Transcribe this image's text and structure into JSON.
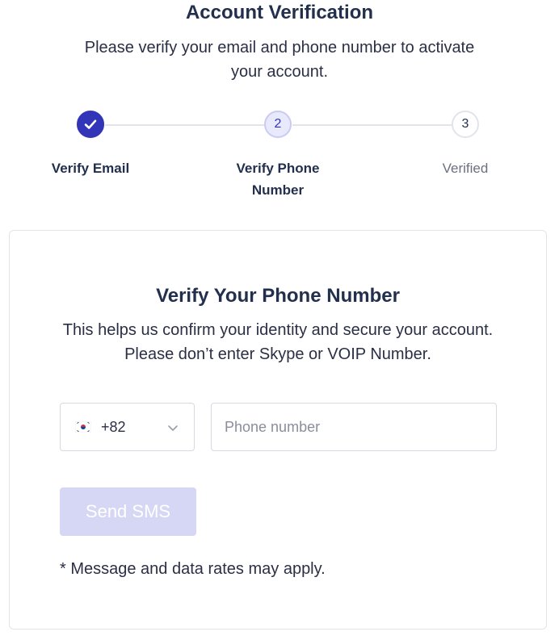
{
  "header": {
    "title": "Account Verification",
    "subtitle": "Please verify your email and phone number to activate your account."
  },
  "stepper": {
    "steps": [
      {
        "number": "1",
        "label": "Verify Email",
        "state": "completed",
        "icon": "check-icon"
      },
      {
        "number": "2",
        "label": "Verify Phone Number",
        "state": "active"
      },
      {
        "number": "3",
        "label": "Verified",
        "state": "pending"
      }
    ]
  },
  "card": {
    "title": "Verify Your Phone Number",
    "description": "This helps us confirm your identity and secure your account. Please don’t enter Skype or VOIP Number.",
    "country_select": {
      "flag_icon": "south-korea-flag-icon",
      "dial_code": "+82"
    },
    "phone_input": {
      "value": "",
      "placeholder": "Phone number"
    },
    "send_button": {
      "label": "Send SMS",
      "disabled": true
    },
    "note": "* Message and data rates may apply."
  },
  "colors": {
    "primary": "#3235b8",
    "primary_light": "#e8e9fb",
    "button_disabled": "#d6d7f5",
    "heading": "#22304d",
    "muted": "#6b7080",
    "border": "#e3e4ea"
  }
}
